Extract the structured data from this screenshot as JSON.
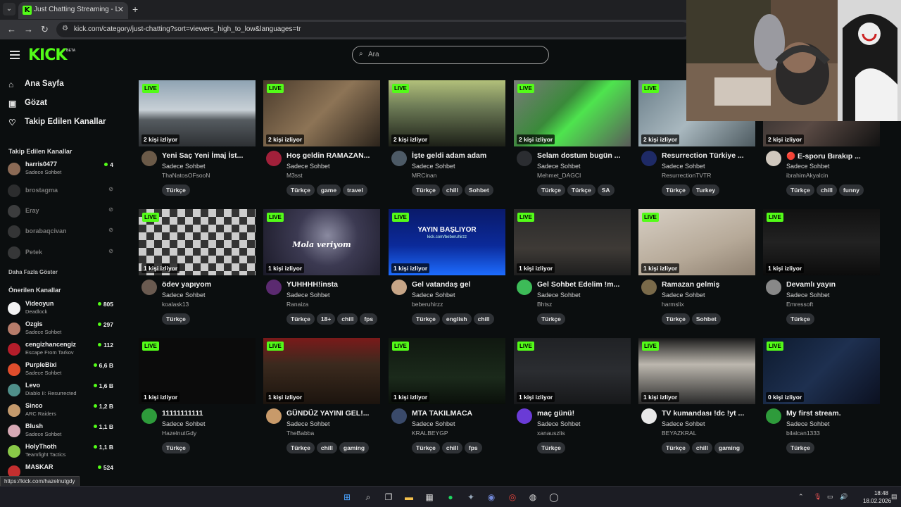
{
  "browser": {
    "tab_title": "Just Chatting Streaming - Live S",
    "url": "kick.com/category/just-chatting?sort=viewers_high_to_low&languages=tr",
    "status_url": "https://kick.com/hazelnutgdy"
  },
  "header": {
    "logo": "KICK",
    "logo_badge": "BETA",
    "search_placeholder": "Ara"
  },
  "sidebar": {
    "nav": [
      {
        "label": "Ana Sayfa",
        "icon": "home-icon"
      },
      {
        "label": "Gözat",
        "icon": "browse-icon"
      },
      {
        "label": "Takip Edilen Kanallar",
        "icon": "heart-icon"
      }
    ],
    "following_title": "Takip Edilen Kanallar",
    "following": [
      {
        "name": "harris0477",
        "sub": "Sadece Sohbet",
        "viewers": "4",
        "online": true
      },
      {
        "name": "brostagma",
        "online": false
      },
      {
        "name": "Eray",
        "online": false
      },
      {
        "name": "borabaqcivan",
        "online": false
      },
      {
        "name": "Petek",
        "online": false
      }
    ],
    "show_more": "Daha Fazla Göster",
    "recommended_title": "Önerilen Kanallar",
    "recommended": [
      {
        "name": "Videoyun",
        "sub": "Deadlock",
        "viewers": "805"
      },
      {
        "name": "Ozgis",
        "sub": "Sadece Sohbet",
        "viewers": "297"
      },
      {
        "name": "cengizhancengiz",
        "sub": "Escape From Tarkov",
        "viewers": "112"
      },
      {
        "name": "PurpleBixi",
        "sub": "Sadece Sohbet",
        "viewers": "6,6 B"
      },
      {
        "name": "Levo",
        "sub": "Diablo II: Resurrected",
        "viewers": "1,6 B"
      },
      {
        "name": "Sinco",
        "sub": "ARC Raiders",
        "viewers": "1,2 B"
      },
      {
        "name": "Blush",
        "sub": "Sadece Sohbet",
        "viewers": "1,1 B"
      },
      {
        "name": "HolyThoth",
        "sub": "Teamfight Tactics",
        "viewers": "1,1 B"
      },
      {
        "name": "MASKAR",
        "sub": "",
        "viewers": "524"
      }
    ]
  },
  "live_label": "LIVE",
  "streams": [
    {
      "viewers": "2 kişi izliyor",
      "title": "Yeni Saç Yeni İmaj İst...",
      "category": "Sadece Sohbet",
      "channel": "ThaNatosOFsooN",
      "tags": [
        "Türkçe"
      ]
    },
    {
      "viewers": "2 kişi izliyor",
      "title": "Hoş geldin RAMAZAN...",
      "category": "Sadece Sohbet",
      "channel": "M3sst",
      "tags": [
        "Türkçe",
        "game",
        "travel"
      ]
    },
    {
      "viewers": "2 kişi izliyor",
      "title": "İşte geldi adam adam",
      "category": "Sadece Sohbet",
      "channel": "MRCinan",
      "tags": [
        "Türkçe",
        "chill",
        "Sohbet"
      ]
    },
    {
      "viewers": "2 kişi izliyor",
      "title": "Selam dostum bugün ...",
      "category": "Sadece Sohbet",
      "channel": "Mehmet_DAGCI",
      "tags": [
        "Türkçe",
        "Türkçe",
        "SA"
      ]
    },
    {
      "viewers": "2 kişi izliyor",
      "title": "Resurrection Türkiye ...",
      "category": "Sadece Sohbet",
      "channel": "ResurrectionTVTR",
      "tags": [
        "Türkçe",
        "Turkey"
      ]
    },
    {
      "viewers": "2 kişi izliyor",
      "title": "🔴 E-sporu Bırakıp ...",
      "category": "Sadece Sohbet",
      "channel": "ibrahimAkyalcin",
      "tags": [
        "Türkçe",
        "chill",
        "funny"
      ]
    },
    {
      "viewers": "1 kişi izliyor",
      "title": "ödev yapıyom",
      "category": "Sadece Sohbet",
      "channel": "koalask13",
      "tags": [
        "Türkçe"
      ]
    },
    {
      "viewers": "1 kişi izliyor",
      "title": "YUHHHH!insta",
      "category": "Sadece Sohbet",
      "channel": "Ranaiza",
      "tags": [
        "Türkçe",
        "18+",
        "chill",
        "fps"
      ],
      "overlay_text": "Mola veriyom"
    },
    {
      "viewers": "1 kişi izliyor",
      "title": "Gel vatandaş gel",
      "category": "Sadece Sohbet",
      "channel": "beberuhirzz",
      "tags": [
        "Türkçe",
        "english",
        "chill"
      ],
      "overlay_text": "YAYIN BAŞLIYOR",
      "overlay_sub": "kick.com/beberuhirzz"
    },
    {
      "viewers": "1 kişi izliyor",
      "title": "Gel Sohbet Edelim !m...",
      "category": "Sadece Sohbet",
      "channel": "Bhtsz",
      "tags": [
        "Türkçe"
      ]
    },
    {
      "viewers": "1 kişi izliyor",
      "title": "Ramazan gelmiş",
      "category": "Sadece Sohbet",
      "channel": "harmslix",
      "tags": [
        "Türkçe",
        "Sohbet"
      ]
    },
    {
      "viewers": "1 kişi izliyor",
      "title": "Devamlı yayın",
      "category": "Sadece Sohbet",
      "channel": "Emressoft",
      "tags": [
        "Türkçe"
      ]
    },
    {
      "viewers": "1 kişi izliyor",
      "title": "11111111111",
      "category": "Sadece Sohbet",
      "channel": "HazelnutGdy",
      "tags": [
        "Türkçe"
      ]
    },
    {
      "viewers": "1 kişi izliyor",
      "title": "GÜNDÜZ YAYINI GEL!...",
      "category": "Sadece Sohbet",
      "channel": "TheBabba",
      "tags": [
        "Türkçe",
        "chill",
        "gaming"
      ]
    },
    {
      "viewers": "1 kişi izliyor",
      "title": "MTA TAKILMACA",
      "category": "Sadece Sohbet",
      "channel": "KRALBEYGP",
      "tags": [
        "Türkçe",
        "chill",
        "fps"
      ]
    },
    {
      "viewers": "1 kişi izliyor",
      "title": "maç günü!",
      "category": "Sadece Sohbet",
      "channel": "xanauszlis",
      "tags": [
        "Türkçe"
      ]
    },
    {
      "viewers": "1 kişi izliyor",
      "title": "TV kumandası !dc !yt ...",
      "category": "Sadece Sohbet",
      "channel": "BEYAZKRAL",
      "tags": [
        "Türkçe",
        "chill",
        "gaming"
      ]
    },
    {
      "viewers": "0 kişi izliyor",
      "title": "My first stream.",
      "category": "Sadece Sohbet",
      "channel": "bilalcan1333",
      "tags": [
        "Türkçe"
      ]
    }
  ],
  "taskbar": {
    "time": "18:48",
    "date": "18.02.2026"
  },
  "colors": {
    "accent": "#53fc18",
    "background": "#0b0e0f"
  }
}
